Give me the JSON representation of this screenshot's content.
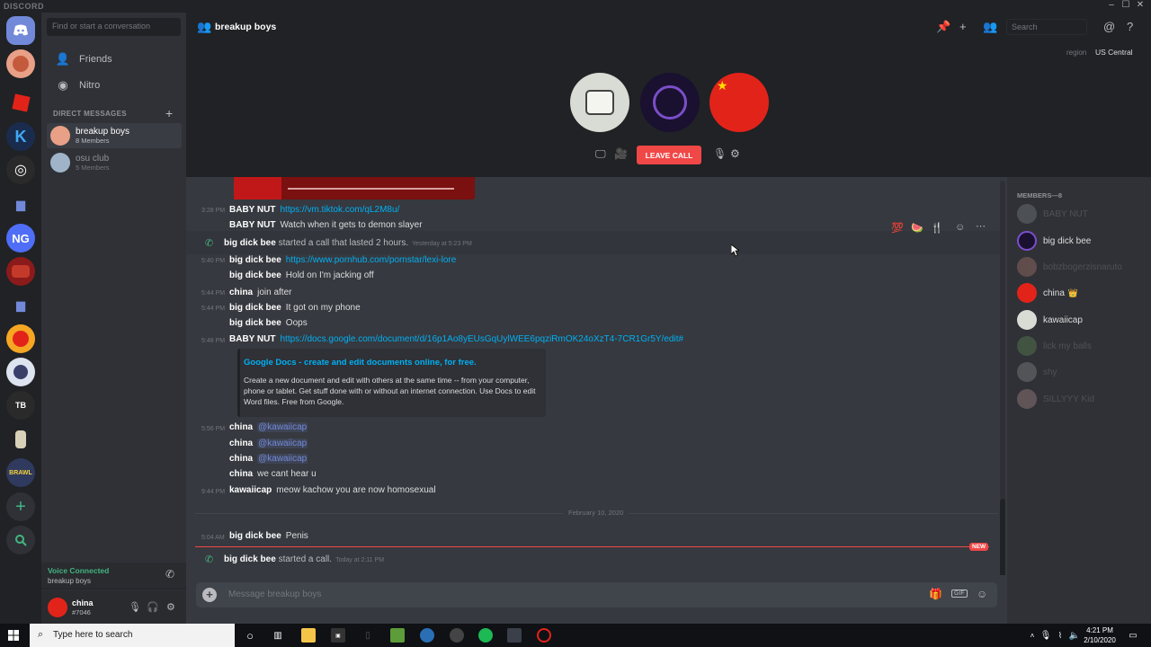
{
  "titlebar": {
    "app": "DISCORD",
    "minimize": "–",
    "maximize": "☐",
    "close": "✕"
  },
  "sidebar": {
    "search_placeholder": "Find or start a conversation",
    "nav": [
      {
        "label": "Friends"
      },
      {
        "label": "Nitro"
      }
    ],
    "dm_header": "DIRECT MESSAGES",
    "dms": [
      {
        "name": "breakup boys",
        "sub": "8 Members"
      },
      {
        "name": "osu club",
        "sub": "5 Members"
      }
    ]
  },
  "voice": {
    "status": "Voice Connected",
    "channel": "breakup boys"
  },
  "user": {
    "name": "china",
    "tag": "#7046"
  },
  "topbar": {
    "channel": "breakup boys",
    "search_placeholder": "Search"
  },
  "call": {
    "region_label": "region",
    "region": "US Central",
    "leave_label": "LEAVE CALL"
  },
  "messages": {
    "m1": {
      "time": "3:28 PM",
      "author": "BABY NUT",
      "link": "https://vm.tiktok.com/qL2M8u/"
    },
    "m2": {
      "author": "BABY NUT",
      "text": "Watch when it gets to demon slayer"
    },
    "s1": {
      "author": "big dick bee",
      "text": " started a call that lasted 2 hours.",
      "ts": "Yesterday at 5:23 PM"
    },
    "m3": {
      "time": "5:40 PM",
      "author": "big dick bee",
      "link": "https://www.pornhub.com/pornstar/lexi-lore"
    },
    "m4": {
      "author": "big dick bee",
      "text": "Hold on I'm jacking off"
    },
    "m5": {
      "time": "5:44 PM",
      "author": "china",
      "text": "join after"
    },
    "m6": {
      "time": "5:44 PM",
      "author": "big dick bee",
      "text": "It got on my phone"
    },
    "m7": {
      "author": "big dick bee",
      "text": "Oops"
    },
    "m8": {
      "time": "5:48 PM",
      "author": "BABY NUT",
      "link": "https://docs.google.com/document/d/16p1Ao8yEUsGqUylWEE6pqziRmOK24oXzT4-7CR1Gr5Y/edit#"
    },
    "embed": {
      "title": "Google Docs - create and edit documents online, for free.",
      "desc": "Create a new document and edit with others at the same time -- from your computer, phone or tablet. Get stuff done with or without an internet connection. Use Docs to edit Word files. Free from Google."
    },
    "m9": {
      "time": "5:56 PM",
      "author": "china",
      "mention": "@kawaiicap"
    },
    "m10": {
      "author": "china",
      "mention": "@kawaiicap"
    },
    "m11": {
      "author": "china",
      "mention": "@kawaiicap"
    },
    "m12": {
      "author": "china",
      "text": "we cant hear u"
    },
    "m13": {
      "time": "9:44 PM",
      "author": "kawaiicap",
      "text": "meow kachow you are now homosexual"
    },
    "date_divider": "February 10, 2020",
    "m14": {
      "time": "5:04 AM",
      "author": "big dick bee",
      "text": "Penis"
    },
    "new_badge": "NEW",
    "s2": {
      "author": "big dick bee",
      "text": " started a call.",
      "ts": "Today at 2:11 PM"
    }
  },
  "composer": {
    "placeholder": "Message breakup boys",
    "gif": "GIF"
  },
  "members": {
    "header": "MEMBERS—8",
    "list": [
      {
        "name": "BABY NUT",
        "online": false
      },
      {
        "name": "big dick bee",
        "online": true
      },
      {
        "name": "bobzbogerzisnaruto",
        "online": false
      },
      {
        "name": "china",
        "online": true,
        "owner": "👑"
      },
      {
        "name": "kawaiicap",
        "online": true
      },
      {
        "name": "lick my balls",
        "online": false
      },
      {
        "name": "shy",
        "online": false
      },
      {
        "name": "SILLYYY Kid",
        "online": false
      }
    ]
  },
  "taskbar": {
    "search_placeholder": "Type here to search",
    "time": "4:21 PM",
    "date": "2/10/2020"
  },
  "colors": {
    "accent": "#7289da",
    "link": "#00b0f4",
    "danger": "#f04747",
    "online": "#43b581"
  }
}
